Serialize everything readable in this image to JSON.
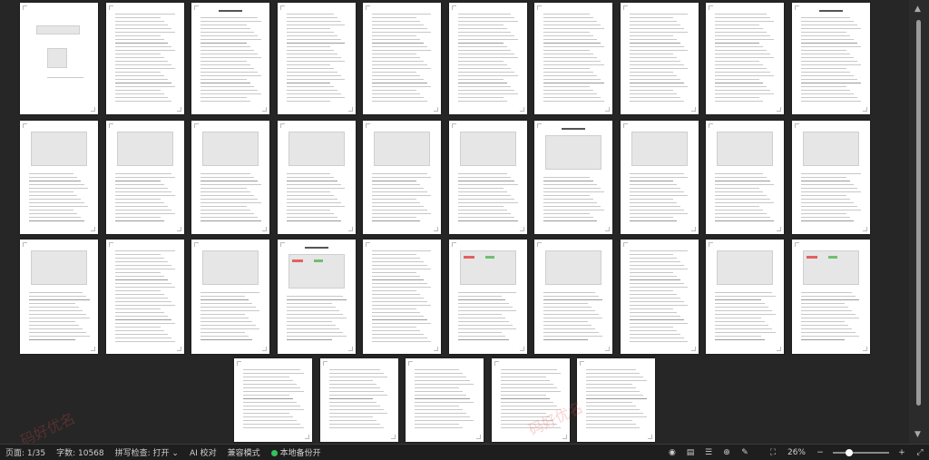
{
  "status": {
    "page": "页面: 1/35",
    "words": "字数: 10568",
    "spell": "拼写检查: 打开",
    "ai": "AI 校对",
    "compat": "兼容模式",
    "backup": "本地备份开",
    "zoom": "26%"
  },
  "zoom_fraction": 0.26,
  "watermark": [
    "码好优名",
    "码好优名"
  ]
}
